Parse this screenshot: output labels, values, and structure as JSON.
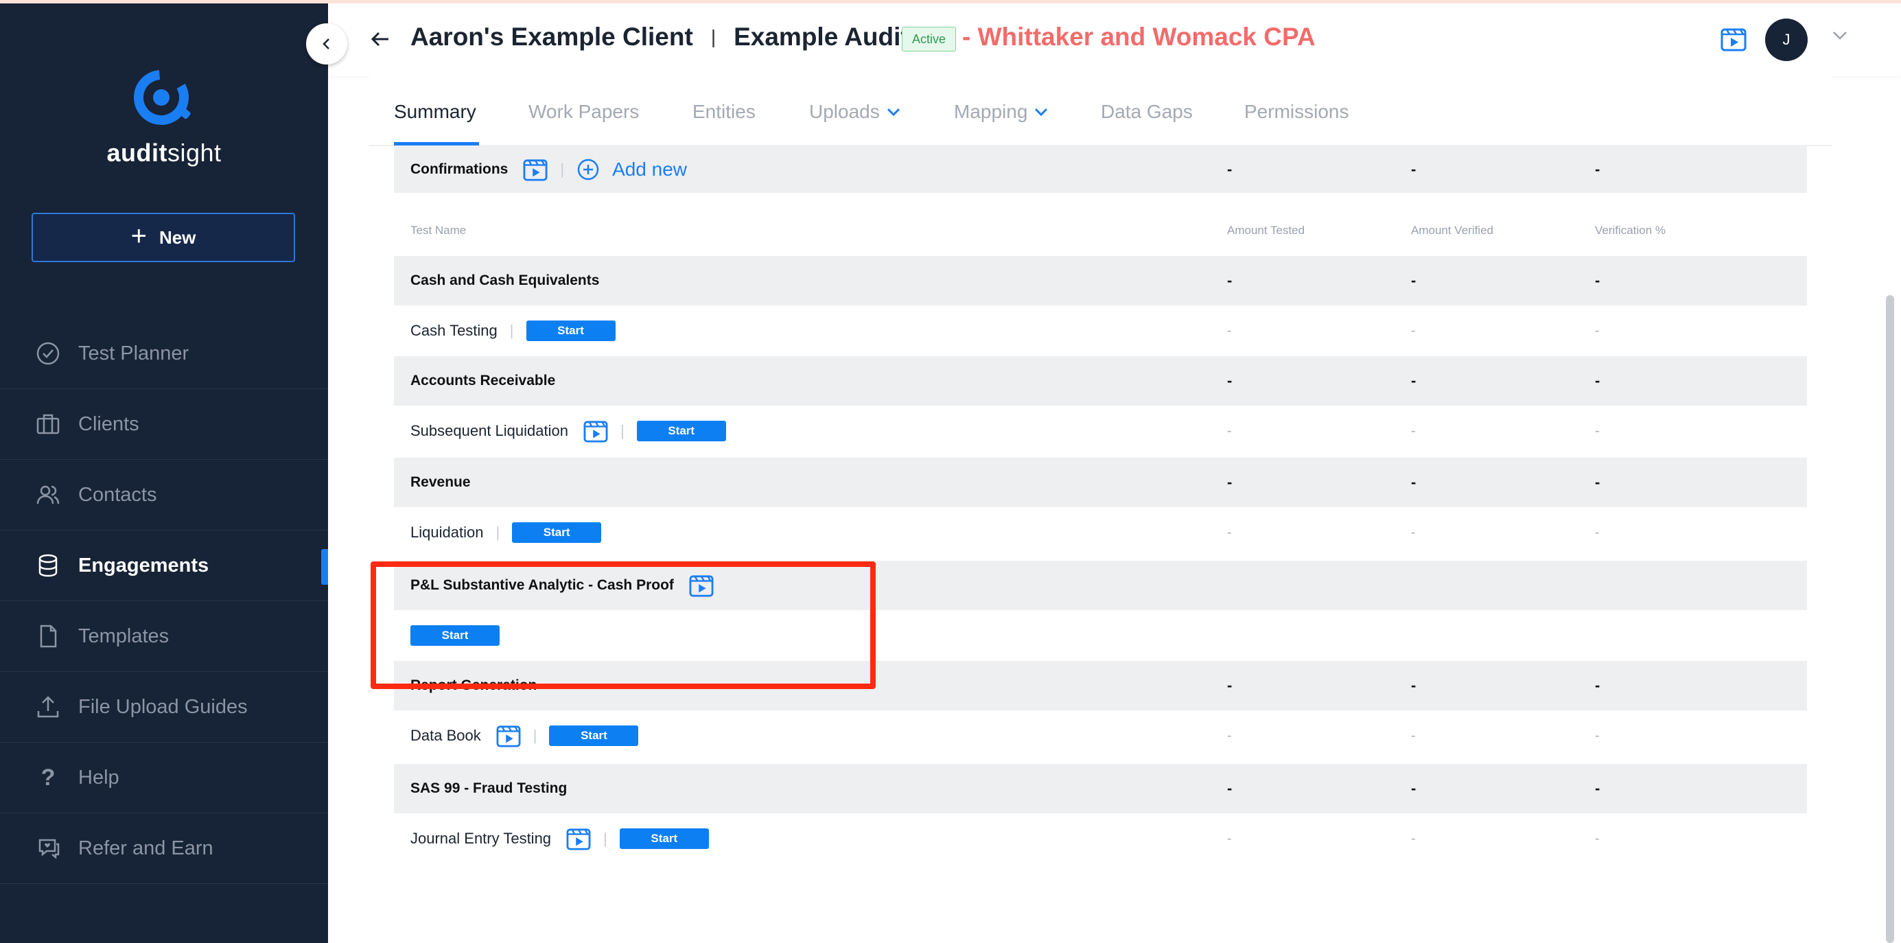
{
  "sidebar": {
    "logo_bold": "audit",
    "logo_light": "sight",
    "new_label": "New",
    "items": [
      {
        "label": "Test Planner",
        "icon": "check-circle-icon"
      },
      {
        "label": "Clients",
        "icon": "briefcase-icon"
      },
      {
        "label": "Contacts",
        "icon": "users-icon"
      },
      {
        "label": "Engagements",
        "icon": "database-icon",
        "active": true
      },
      {
        "label": "Templates",
        "icon": "file-icon"
      },
      {
        "label": "File Upload Guides",
        "icon": "upload-icon"
      },
      {
        "label": "Help",
        "icon": "question-icon"
      },
      {
        "label": "Refer and Earn",
        "icon": "chat-heart-icon"
      }
    ]
  },
  "header": {
    "client": "Aaron's Example Client",
    "separator": "|",
    "audit": "Example Audit",
    "status": "Active",
    "firm": "- Whittaker and Womack CPA",
    "avatar_initial": "J"
  },
  "tabs": [
    {
      "label": "Summary",
      "active": true
    },
    {
      "label": "Work Papers"
    },
    {
      "label": "Entities"
    },
    {
      "label": "Uploads",
      "dropdown": true
    },
    {
      "label": "Mapping",
      "dropdown": true
    },
    {
      "label": "Data Gaps"
    },
    {
      "label": "Permissions"
    }
  ],
  "confirmations": {
    "label": "Confirmations",
    "add_new": "Add new",
    "amount_tested": "-",
    "amount_verified": "-",
    "verification_pct": "-"
  },
  "columns": {
    "test_name": "Test Name",
    "amount_tested": "Amount Tested",
    "amount_verified": "Amount Verified",
    "verification_pct": "Verification %"
  },
  "groups": [
    {
      "name": "Cash and Cash Equivalents",
      "v1": "-",
      "v2": "-",
      "v3": "-",
      "test": {
        "name": "Cash Testing",
        "start": "Start",
        "v1": "-",
        "v2": "-",
        "v3": "-"
      }
    },
    {
      "name": "Accounts Receivable",
      "v1": "-",
      "v2": "-",
      "v3": "-",
      "test": {
        "name": "Subsequent Liquidation",
        "start": "Start",
        "v1": "-",
        "v2": "-",
        "v3": "-"
      }
    },
    {
      "name": "Revenue",
      "v1": "-",
      "v2": "-",
      "v3": "-",
      "test": {
        "name": "Liquidation",
        "start": "Start",
        "v1": "-",
        "v2": "-",
        "v3": "-"
      }
    },
    {
      "name": "P&L Substantive Analytic - Cash Proof",
      "test": {
        "start": "Start"
      }
    },
    {
      "name": "Report Generation",
      "v1": "-",
      "v2": "-",
      "v3": "-",
      "test": {
        "name": "Data Book",
        "start": "Start",
        "v1": "-",
        "v2": "-",
        "v3": "-"
      }
    },
    {
      "name": "SAS 99 - Fraud Testing",
      "v1": "-",
      "v2": "-",
      "v3": "-",
      "test": {
        "name": "Journal Entry Testing",
        "start": "Start",
        "v1": "-",
        "v2": "-",
        "v3": "-"
      }
    }
  ],
  "colors": {
    "sidebar_bg": "#172336",
    "accent_blue": "#0c7ff2",
    "firm_red": "#f36b6b",
    "highlight_red": "#ff2a12",
    "active_badge_green": "#2f9a52"
  }
}
